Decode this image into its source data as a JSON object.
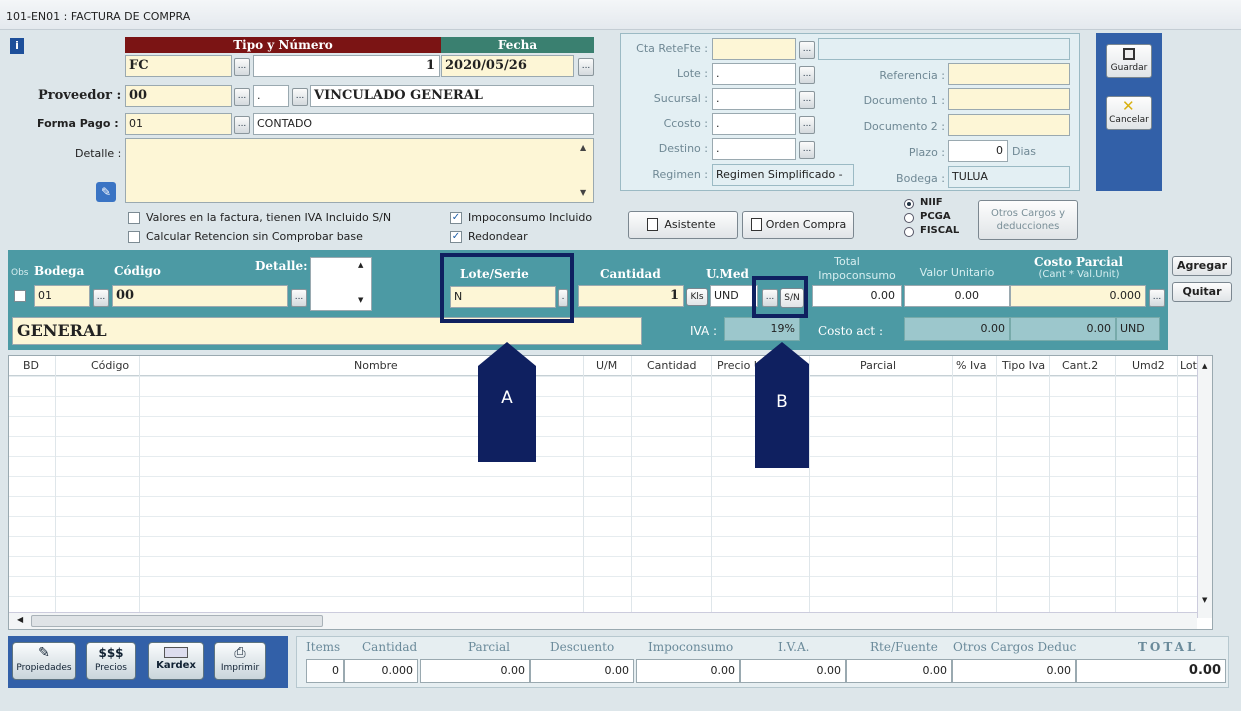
{
  "window": {
    "title": "101-EN01 : FACTURA DE COMPRA"
  },
  "header": {
    "tipo_numero_label": "Tipo y Número",
    "fecha_label": "Fecha",
    "tipo": "FC",
    "numero": "1",
    "fecha": "2020/05/26",
    "proveedor_label": "Proveedor :",
    "proveedor_code": "00",
    "proveedor_dot": ".",
    "proveedor_name": "VINCULADO GENERAL",
    "forma_pago_label": "Forma Pago :",
    "forma_pago_code": "01",
    "forma_pago_name": "CONTADO",
    "detalle_label": "Detalle :",
    "iva_incluido": "Valores en la factura, tienen  IVA Incluido S/N",
    "calc_retencion": "Calcular Retencion sin Comprobar base",
    "impoconsumo_incluido": "Impoconsumo Incluido",
    "redondear": "Redondear"
  },
  "right": {
    "cta_retefte": "Cta ReteFte :",
    "lote": "Lote :",
    "lote_val": ".",
    "sucursal": "Sucursal :",
    "sucursal_val": ".",
    "ccosto": "Ccosto :",
    "ccosto_val": ".",
    "destino": "Destino :",
    "destino_val": ".",
    "regimen": "Regimen :",
    "regimen_val": "Regimen Simplificado -",
    "referencia": "Referencia :",
    "documento1": "Documento 1 :",
    "documento2": "Documento 2 :",
    "plazo": "Plazo :",
    "plazo_val": "0",
    "dias": "Dias",
    "bodega": "Bodega :",
    "bodega_val": "TULUA"
  },
  "buttons": {
    "guardar": "Guardar",
    "cancelar": "Cancelar",
    "asistente": "Asistente",
    "orden_compra": "Orden Compra",
    "otros_cargos": "Otros Cargos y deducciones",
    "agregar": "Agregar",
    "quitar": "Quitar",
    "sn": "S/N"
  },
  "norms": {
    "niif": "NIIF",
    "pcga": "PCGA",
    "fiscal": "FISCAL"
  },
  "entry": {
    "obs": "Obs",
    "bodega_h": "Bodega",
    "codigo_h": "Código",
    "detalle_h": "Detalle:",
    "lote_h": "Lote/Serie",
    "cantidad_h": "Cantidad",
    "umed_h": "U.Med",
    "total_h": "Total",
    "impoconsumo_h": "Impoconsumo",
    "valor_unit_h": "Valor Unitario",
    "costo_parcial_h": "Costo Parcial",
    "cant_val_h": "(Cant * Val.Unit)",
    "bodega": "01",
    "codigo": "00",
    "lote": "N",
    "cantidad": "1",
    "kls": "Kls",
    "umed": "UND",
    "total": "0.00",
    "valor_unit": "0.00",
    "costo_parcial": "0.000",
    "nombre": "GENERAL",
    "iva_label": "IVA :",
    "iva": "19%",
    "costo_act_label": "Costo act :",
    "costo_act": "0.00",
    "costo_act2": "0.00",
    "und": "UND"
  },
  "grid": {
    "columns": [
      "BD",
      "Código",
      "Nombre",
      "U/M",
      "Cantidad",
      "Precio U",
      "Parcial",
      "% Iva",
      "Tipo Iva",
      "Cant.2",
      "Umd2",
      "Lote"
    ]
  },
  "toolbar": {
    "propiedades": "Propiedades",
    "precios": "Precios",
    "precios_sym": "$$$",
    "kardex": "Kardex",
    "imprimir": "Imprimir"
  },
  "totals": {
    "labels": [
      "Items",
      "Cantidad",
      "Parcial",
      "Descuento",
      "Impoconsumo",
      "I.V.A.",
      "Rte/Fuente",
      "Otros Cargos Deduc",
      "TOTAL"
    ],
    "values": [
      "0",
      "0.000",
      "0.00",
      "0.00",
      "0.00",
      "0.00",
      "0.00",
      "0.00",
      "0.00"
    ]
  },
  "callouts": {
    "a": "A",
    "b": "B"
  }
}
